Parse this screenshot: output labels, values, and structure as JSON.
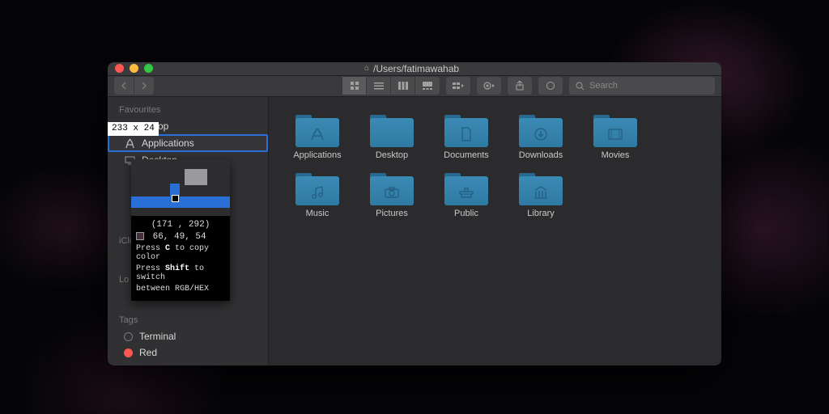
{
  "window": {
    "title_prefix_icon": "home",
    "title": "/Users/fatimawahab",
    "search": {
      "placeholder": "Search"
    }
  },
  "sidebar": {
    "sections": {
      "favourites_label": "Favourites",
      "icloud_label": "iClo",
      "locations_label": "Lo",
      "tags_label": "Tags"
    },
    "favourites": [
      {
        "label": "rop",
        "icon": "airdrop"
      },
      {
        "label": "Applications",
        "icon": "apps",
        "selected": true
      },
      {
        "label": "Desktop",
        "icon": "desktop"
      }
    ],
    "tags": [
      {
        "label": "Terminal",
        "color": "gray"
      },
      {
        "label": "Red",
        "color": "red"
      }
    ]
  },
  "folders": [
    {
      "name": "Applications",
      "glyph": "A"
    },
    {
      "name": "Desktop",
      "glyph": ""
    },
    {
      "name": "Documents",
      "glyph": "doc"
    },
    {
      "name": "Downloads",
      "glyph": "down"
    },
    {
      "name": "Movies",
      "glyph": "mov"
    },
    {
      "name": "Music",
      "glyph": "mus"
    },
    {
      "name": "Pictures",
      "glyph": "pic"
    },
    {
      "name": "Public",
      "glyph": "pub"
    },
    {
      "name": "Library",
      "glyph": "lib"
    }
  ],
  "overlay": {
    "dimensions": "233  x  24",
    "coords": "(171  ,  292)",
    "rgb": " 66,  49,  54",
    "help1_a": "Press ",
    "help1_b": "C",
    "help1_c": " to copy color",
    "help2_a": "Press ",
    "help2_b": "Shift",
    "help2_c": " to switch",
    "help3": "between RGB/HEX"
  }
}
